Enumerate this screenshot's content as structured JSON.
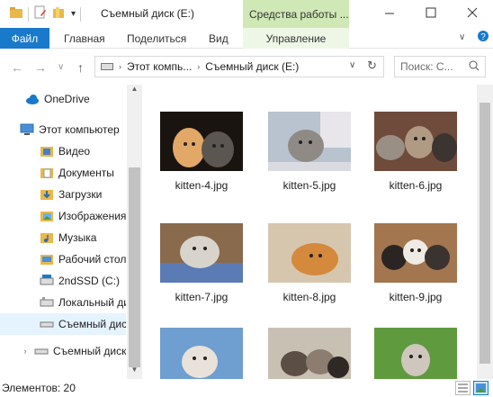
{
  "title": "Съемный диск (E:)",
  "context_tab_title": "Средства работы ...",
  "ribbon": {
    "file": "Файл",
    "home": "Главная",
    "share": "Поделиться",
    "view": "Вид",
    "manage": "Управление"
  },
  "address": {
    "crumbs": [
      "Этот компь...",
      "Съемный диск (E:)"
    ],
    "search_placeholder": "Поиск: С..."
  },
  "nav": {
    "items": [
      {
        "label": "OneDrive",
        "icon": "cloud-icon"
      },
      {
        "label": "Этот компьютер",
        "icon": "computer-icon"
      },
      {
        "label": "Видео",
        "icon": "video-folder-icon"
      },
      {
        "label": "Документы",
        "icon": "documents-folder-icon"
      },
      {
        "label": "Загрузки",
        "icon": "downloads-folder-icon"
      },
      {
        "label": "Изображения",
        "icon": "pictures-folder-icon"
      },
      {
        "label": "Музыка",
        "icon": "music-folder-icon"
      },
      {
        "label": "Рабочий стол",
        "icon": "desktop-folder-icon"
      },
      {
        "label": "2ndSSD (C:)",
        "icon": "drive-icon"
      },
      {
        "label": "Локальный ди",
        "icon": "drive-icon"
      },
      {
        "label": "Съемный дис",
        "icon": "usb-drive-icon"
      },
      {
        "label": "Съемный диск (E",
        "icon": "usb-drive-icon"
      }
    ]
  },
  "files": [
    {
      "name": "kitten-4.jpg"
    },
    {
      "name": "kitten-5.jpg"
    },
    {
      "name": "kitten-6.jpg"
    },
    {
      "name": "kitten-7.jpg"
    },
    {
      "name": "kitten-8.jpg"
    },
    {
      "name": "kitten-9.jpg"
    },
    {
      "name": ""
    },
    {
      "name": ""
    },
    {
      "name": ""
    }
  ],
  "status": {
    "items_count": "Элементов: 20"
  },
  "colors": {
    "accent": "#1979ca",
    "context_tab": "#cfe8b5",
    "selection": "#e5f3ff"
  }
}
